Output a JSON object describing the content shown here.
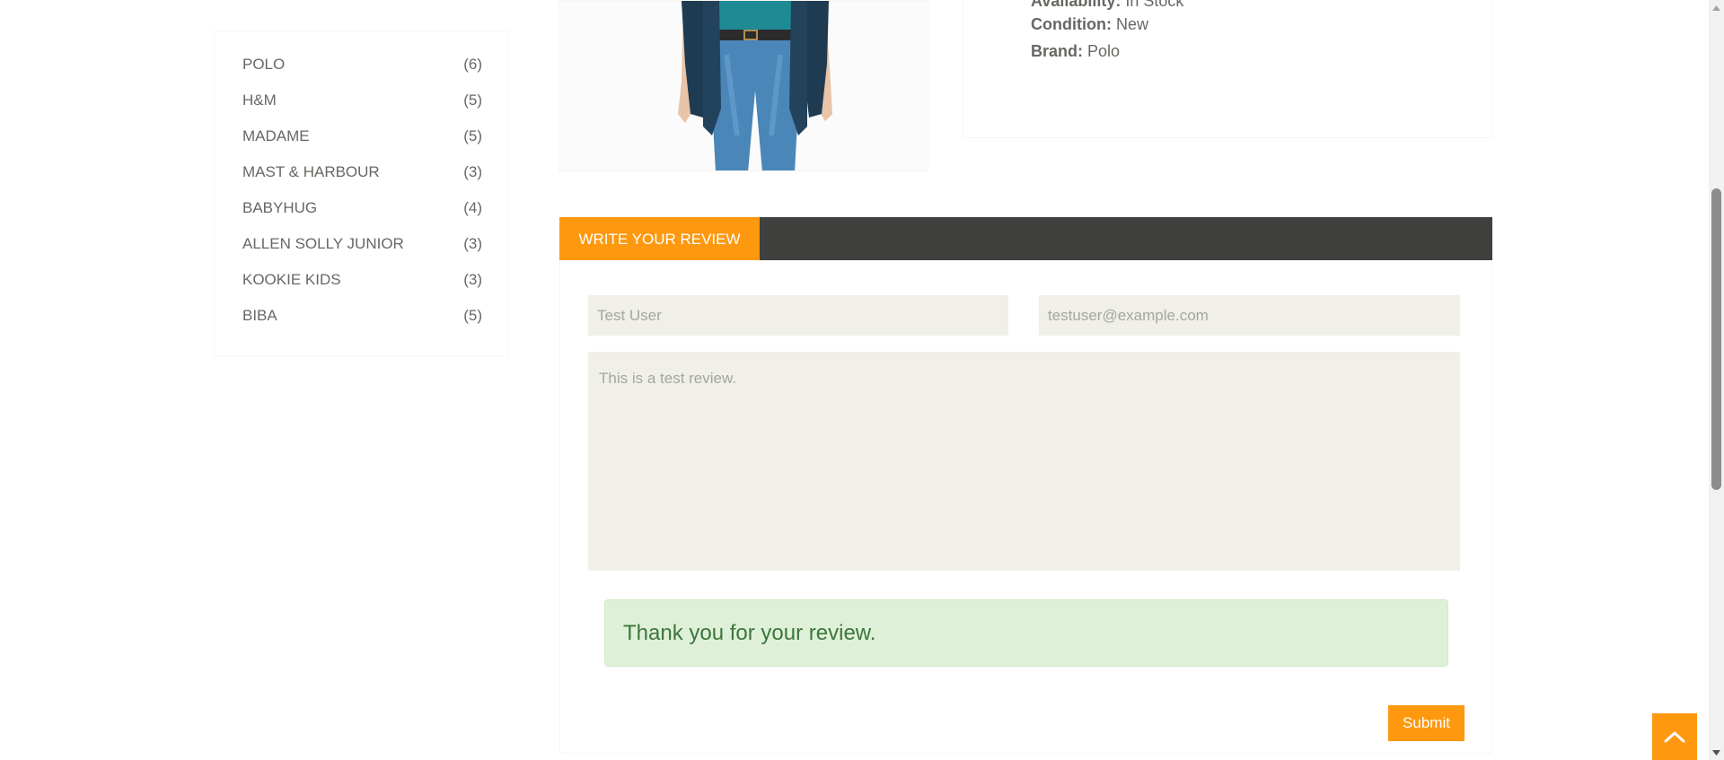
{
  "brands": [
    {
      "name": "POLO",
      "count": "(6)"
    },
    {
      "name": "H&M",
      "count": "(5)"
    },
    {
      "name": "MADAME",
      "count": "(5)"
    },
    {
      "name": "MAST & HARBOUR",
      "count": "(3)"
    },
    {
      "name": "BABYHUG",
      "count": "(4)"
    },
    {
      "name": "ALLEN SOLLY JUNIOR",
      "count": "(3)"
    },
    {
      "name": "KOOKIE KIDS",
      "count": "(3)"
    },
    {
      "name": "BIBA",
      "count": "(5)"
    }
  ],
  "product": {
    "availability_label": "Availability:",
    "availability_value": "In Stock",
    "condition_label": "Condition:",
    "condition_value": "New",
    "brand_label": "Brand:",
    "brand_value": "Polo"
  },
  "review": {
    "tab_label": "WRITE YOUR REVIEW",
    "name_value": "Test User",
    "email_value": "testuser@example.com",
    "review_value": "This is a test review.",
    "success_message": "Thank you for your review.",
    "submit_label": "Submit"
  },
  "icons": {
    "scroll_up": "chevron-up-icon"
  },
  "colors": {
    "accent": "#fe980f",
    "tab_bar": "#40403e",
    "input_bg": "#f0f0e9",
    "success_bg": "#dff0d8",
    "success_text": "#3c763d"
  }
}
